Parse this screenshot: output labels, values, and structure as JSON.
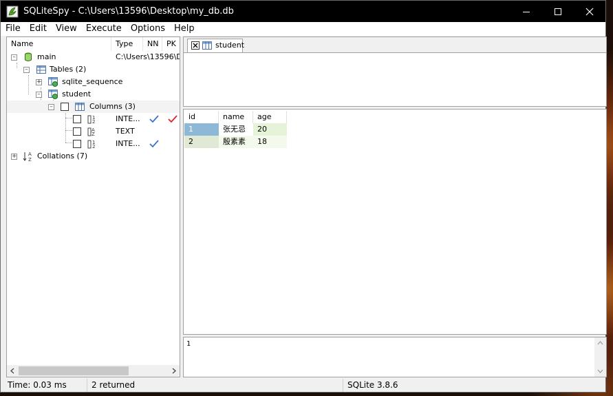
{
  "window": {
    "title": "SQLiteSpy - C:\\Users\\13596\\Desktop\\my_db.db"
  },
  "menu": [
    "File",
    "Edit",
    "View",
    "Execute",
    "Options",
    "Help"
  ],
  "tree": {
    "headers": {
      "name": "Name",
      "type": "Type",
      "nn": "NN",
      "pk": "PK"
    },
    "db": {
      "label": "main",
      "path": "C:\\Users\\13596\\De"
    },
    "tables": {
      "label": "Tables (2)"
    },
    "table1": {
      "label": "sqlite_sequence"
    },
    "table2": {
      "label": "student"
    },
    "columns": {
      "label": "Columns (3)"
    },
    "col_types": [
      "INTE...",
      "TEXT",
      "INTE..."
    ],
    "collations": {
      "label": "Collations (7)"
    }
  },
  "sql_tab": {
    "label": "student"
  },
  "results": {
    "columns": [
      "id",
      "name",
      "age"
    ],
    "rows": [
      [
        "1",
        "张无忌",
        "20"
      ],
      [
        "2",
        "殷素素",
        "18"
      ]
    ]
  },
  "message": {
    "text": "1"
  },
  "status": {
    "time": "Time: 0.03 ms",
    "returned": "2 returned",
    "version": "SQLite 3.8.6"
  },
  "colors": {
    "titlebar": "#000000",
    "selected_cell": "#8eb9d6",
    "row_tint": "#e6f3d8",
    "check_blue": "#3b6fd1",
    "check_red": "#e0202a"
  }
}
